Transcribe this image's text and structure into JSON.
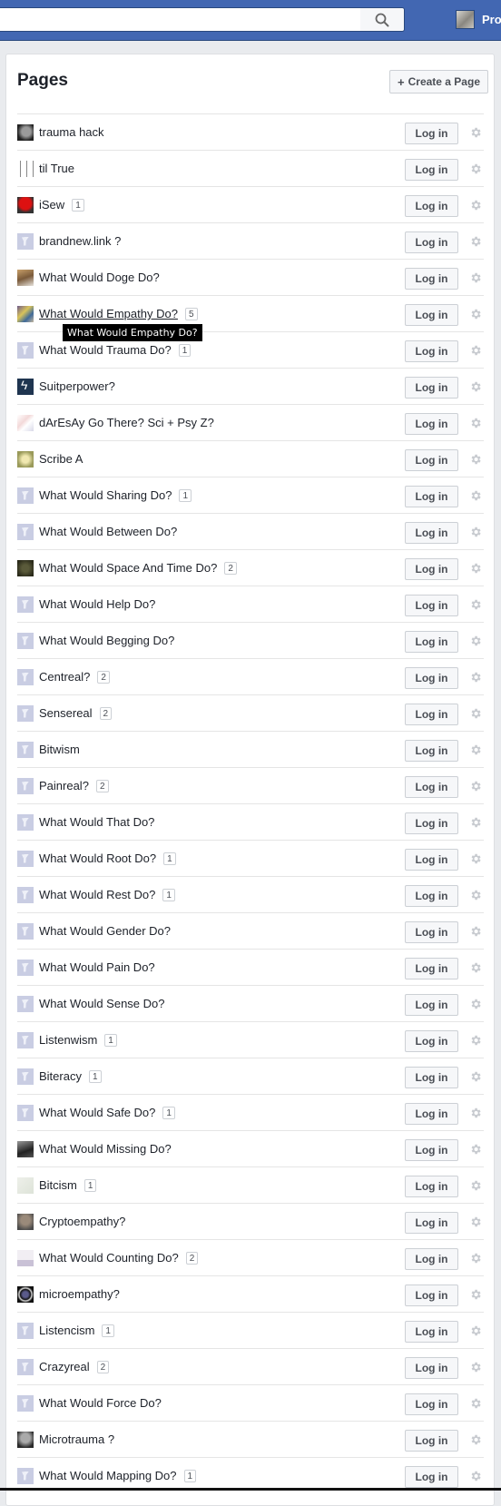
{
  "topbar": {
    "search_placeholder": "",
    "search_value": "",
    "profile_name": "Pro"
  },
  "header": {
    "title": "Pages",
    "create_button_label": "Create a Page",
    "create_button_icon": "plus-icon"
  },
  "row_button_label": "Log in",
  "row_icon": "gear-icon",
  "tooltip": "What Would Empathy Do?",
  "pages": [
    {
      "name": "trauma hack",
      "badge": null,
      "thumb": "photo-dark"
    },
    {
      "name": "til True",
      "badge": null,
      "thumb": "photo-lines"
    },
    {
      "name": "iSew",
      "badge": "1",
      "thumb": "photo-red"
    },
    {
      "name": "brandnew.link ?",
      "badge": null,
      "thumb": "default"
    },
    {
      "name": "What Would Doge Do?",
      "badge": null,
      "thumb": "photo-doge"
    },
    {
      "name": "What Would Empathy Do?",
      "badge": "5",
      "thumb": "photo-color",
      "hovered": true
    },
    {
      "name": "What Would Trauma Do?",
      "badge": "1",
      "thumb": "default"
    },
    {
      "name": "Suitperpower?",
      "badge": null,
      "thumb": "photo-navy"
    },
    {
      "name": "dArEsAy Go There? Sci + Psy Z?",
      "badge": null,
      "thumb": "photo-sketch"
    },
    {
      "name": "Scribe A",
      "badge": null,
      "thumb": "photo-khaki"
    },
    {
      "name": "What Would Sharing Do?",
      "badge": "1",
      "thumb": "default"
    },
    {
      "name": "What Would Between Do?",
      "badge": null,
      "thumb": "default"
    },
    {
      "name": "What Would Space And Time Do?",
      "badge": "2",
      "thumb": "photo-moss"
    },
    {
      "name": "What Would Help Do?",
      "badge": null,
      "thumb": "default"
    },
    {
      "name": "What Would Begging Do?",
      "badge": null,
      "thumb": "default"
    },
    {
      "name": "Centreal?",
      "badge": "2",
      "thumb": "default"
    },
    {
      "name": "Sensereal",
      "badge": "2",
      "thumb": "default"
    },
    {
      "name": "Bitwism",
      "badge": null,
      "thumb": "default"
    },
    {
      "name": "Painreal?",
      "badge": "2",
      "thumb": "default"
    },
    {
      "name": "What Would That Do?",
      "badge": null,
      "thumb": "default"
    },
    {
      "name": "What Would Root Do?",
      "badge": "1",
      "thumb": "default"
    },
    {
      "name": "What Would Rest Do?",
      "badge": "1",
      "thumb": "default"
    },
    {
      "name": "What Would Gender Do?",
      "badge": null,
      "thumb": "default"
    },
    {
      "name": "What Would Pain Do?",
      "badge": null,
      "thumb": "default"
    },
    {
      "name": "What Would Sense Do?",
      "badge": null,
      "thumb": "default"
    },
    {
      "name": "Listenwism",
      "badge": "1",
      "thumb": "default"
    },
    {
      "name": "Biteracy",
      "badge": "1",
      "thumb": "default"
    },
    {
      "name": "What Would Safe Do?",
      "badge": "1",
      "thumb": "default"
    },
    {
      "name": "What Would Missing Do?",
      "badge": null,
      "thumb": "photo-bw"
    },
    {
      "name": "Bitcism",
      "badge": "1",
      "thumb": "photo-pale"
    },
    {
      "name": "Cryptoempathy?",
      "badge": null,
      "thumb": "photo-stone"
    },
    {
      "name": "What Would Counting Do?",
      "badge": "2",
      "thumb": "photo-chart"
    },
    {
      "name": "microempathy?",
      "badge": null,
      "thumb": "photo-lens"
    },
    {
      "name": "Listencism",
      "badge": "1",
      "thumb": "default"
    },
    {
      "name": "Crazyreal",
      "badge": "2",
      "thumb": "default"
    },
    {
      "name": "What Would Force Do?",
      "badge": null,
      "thumb": "default"
    },
    {
      "name": "Microtrauma ?",
      "badge": null,
      "thumb": "photo-gray"
    },
    {
      "name": "What Would Mapping Do?",
      "badge": "1",
      "thumb": "default"
    }
  ]
}
